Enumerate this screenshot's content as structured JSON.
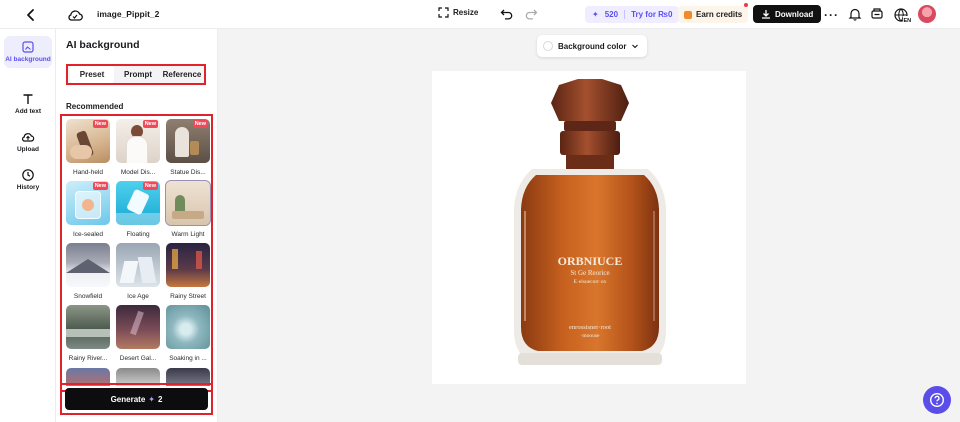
{
  "topbar": {
    "filename": "image_Pippit_20",
    "resize_label": "Resize",
    "credits_count": "520",
    "try_label": "Try for ₨0",
    "earn_label": "Earn credits",
    "download_label": "Download",
    "more_label": "···",
    "lang_label": "EN"
  },
  "rail": {
    "items": [
      {
        "label": "AI background",
        "icon": "ai-background-icon",
        "active": true
      },
      {
        "label": "Add text",
        "icon": "text-icon"
      },
      {
        "label": "Upload",
        "icon": "upload-icon"
      },
      {
        "label": "History",
        "icon": "history-icon"
      }
    ]
  },
  "panel": {
    "title": "AI background",
    "tabs": [
      "Preset",
      "Prompt",
      "Reference"
    ],
    "active_tab": "Preset",
    "section_label": "Recommended",
    "new_badge": "New",
    "presets": [
      {
        "label": "Hand-held",
        "new": true
      },
      {
        "label": "Model Dis...",
        "new": true
      },
      {
        "label": "Statue Dis...",
        "new": true
      },
      {
        "label": "Ice-sealed",
        "new": true
      },
      {
        "label": "Floating",
        "new": true
      },
      {
        "label": "Warm Light",
        "new": false
      },
      {
        "label": "Snowfield",
        "new": false
      },
      {
        "label": "Ice Age",
        "new": false
      },
      {
        "label": "Rainy Street",
        "new": false
      },
      {
        "label": "Rainy River...",
        "new": false
      },
      {
        "label": "Desert Gal...",
        "new": false
      },
      {
        "label": "Soaking in ...",
        "new": false
      }
    ],
    "generate_label": "Generate",
    "generate_cost": "2"
  },
  "canvas": {
    "bg_color_label": "Background color",
    "bottle_text": [
      "ORBNIUCE",
      "St Ge Reorice",
      "E·elsuecorr·ox",
      "enrossisner·root",
      "·moouse"
    ]
  },
  "colors": {
    "accent": "#5b4ee8",
    "highlight_border": "#e0232a",
    "new_badge": "#ef4a5a"
  }
}
